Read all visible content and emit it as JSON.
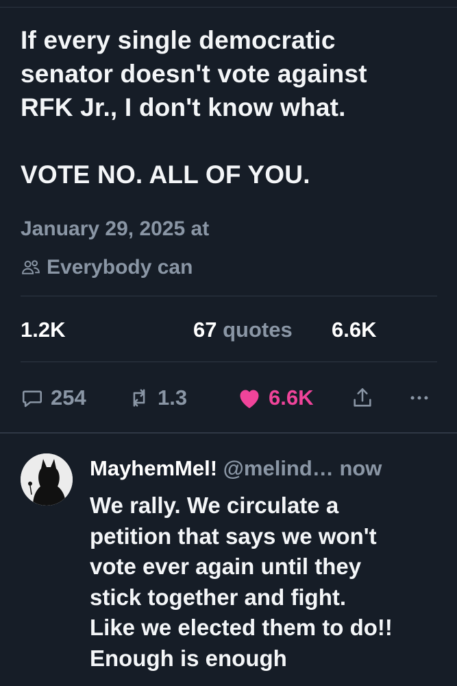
{
  "tweet": {
    "text": "If every single democratic\nsenator doesn't vote against\nRFK Jr., I don't know what.\n\nVOTE NO. ALL OF YOU.",
    "timestamp": "January 29, 2025 at",
    "audience_label": "Everybody can",
    "audience_icon": "people-icon"
  },
  "stats": {
    "reposts": "1.2K",
    "quotes_count": "67",
    "quotes_label": "quotes",
    "likes": "6.6K"
  },
  "actions": {
    "replies": "254",
    "reposts": "1.3",
    "likes": "6.6K",
    "like_color": "#f0449a",
    "icons": [
      "reply-icon",
      "repost-icon",
      "heart-icon",
      "share-icon",
      "more-icon"
    ]
  },
  "reply": {
    "display_name": "MayhemMel!",
    "handle": "@melind…",
    "time": "now",
    "text": "We rally. We circulate a\npetition that says we won't\nvote ever again until they\nstick together and fight.\nLike we elected them to do!!\nEnough is enough"
  },
  "colors": {
    "background": "#161d27",
    "muted": "#8a96a5",
    "accent_like": "#f0449a"
  }
}
